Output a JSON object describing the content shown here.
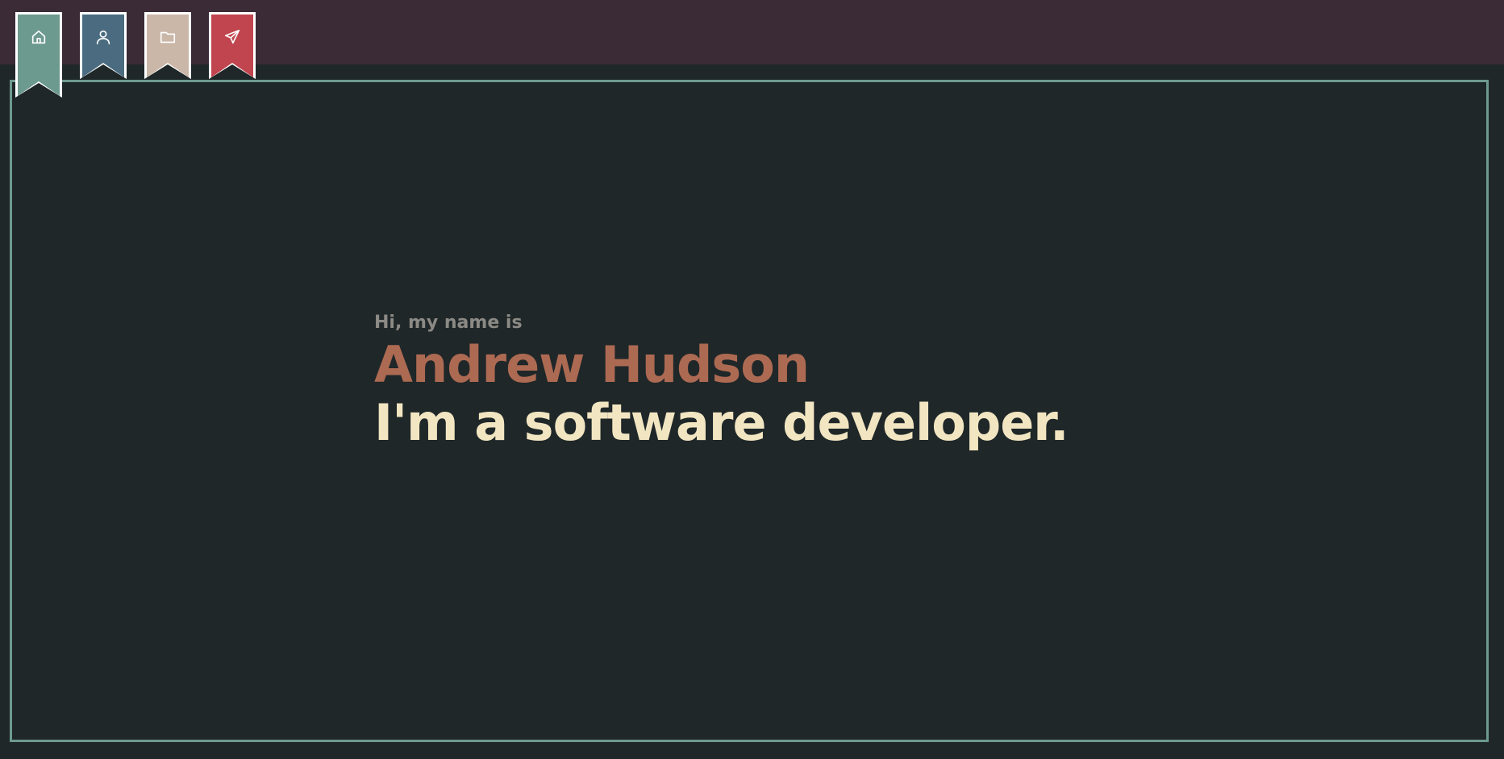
{
  "nav": {
    "items": [
      {
        "id": "home",
        "icon": "home-icon",
        "color": "#6d9a8f",
        "active": true
      },
      {
        "id": "about",
        "icon": "user-icon",
        "color": "#4a6b80",
        "active": false
      },
      {
        "id": "projects",
        "icon": "folder-icon",
        "color": "#cbb7a8",
        "active": false
      },
      {
        "id": "contact",
        "icon": "send-icon",
        "color": "#c0454e",
        "active": false
      }
    ]
  },
  "hero": {
    "greeting": "Hi, my name is",
    "name": "Andrew Hudson",
    "role": "I'm a software developer."
  },
  "colors": {
    "topbar": "#3a2b37",
    "background": "#1f2729",
    "frame_border": "#6d9a8f",
    "name": "#ad6a52",
    "role": "#f2e6c2",
    "greeting": "#8c8a85"
  }
}
